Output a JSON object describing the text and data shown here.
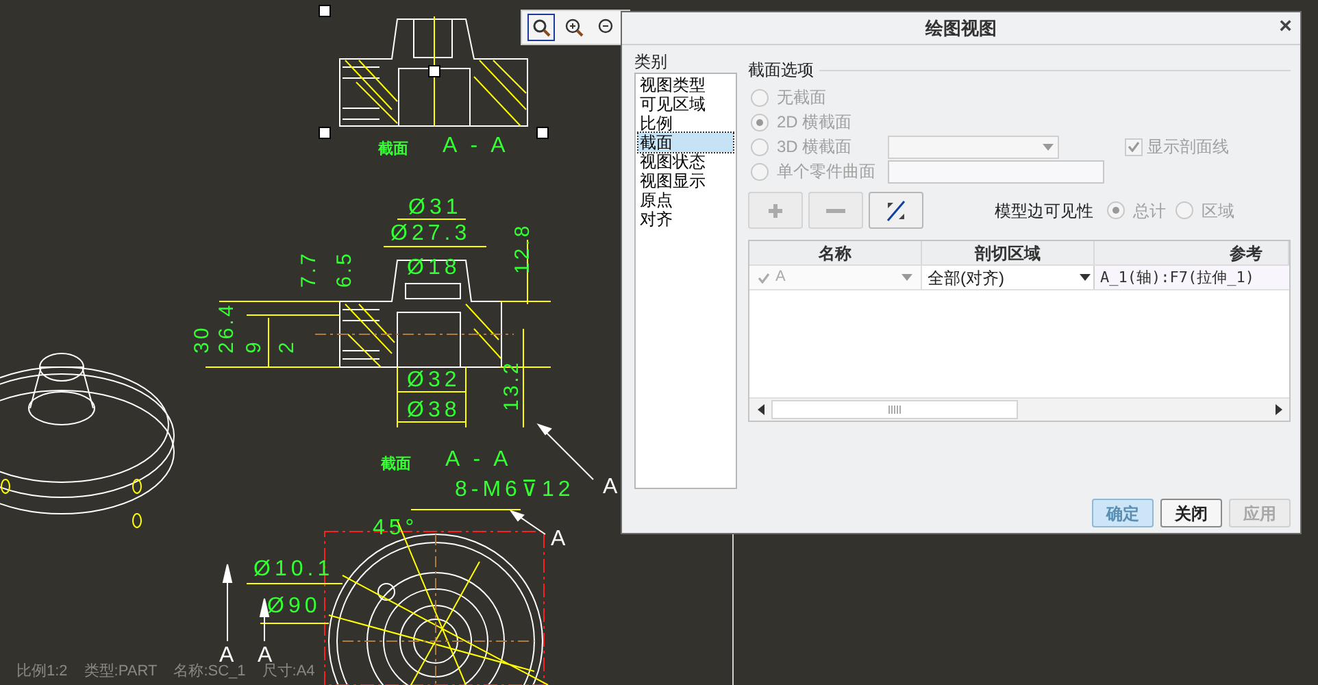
{
  "drawing": {
    "labels": [
      {
        "text": "截面",
        "kind": "caption"
      },
      {
        "text": "A - A",
        "kind": "dim"
      },
      {
        "text": "Ø31",
        "kind": "dim"
      },
      {
        "text": "Ø27.3",
        "kind": "dim"
      },
      {
        "text": "Ø18",
        "kind": "dim"
      },
      {
        "text": "7.7",
        "kind": "dim_v"
      },
      {
        "text": "6.5",
        "kind": "dim_v"
      },
      {
        "text": "12.8",
        "kind": "dim_v"
      },
      {
        "text": "30",
        "kind": "dim_v"
      },
      {
        "text": "26.4",
        "kind": "dim_v"
      },
      {
        "text": "9",
        "kind": "dim_v"
      },
      {
        "text": "2",
        "kind": "dim_v"
      },
      {
        "text": "Ø32",
        "kind": "dim"
      },
      {
        "text": "Ø38",
        "kind": "dim"
      },
      {
        "text": "13.2",
        "kind": "dim_v"
      },
      {
        "text": "截面",
        "kind": "caption"
      },
      {
        "text": "A - A",
        "kind": "dim"
      },
      {
        "text": "8-M6⊽12",
        "kind": "dim"
      },
      {
        "text": "A",
        "kind": "mark"
      },
      {
        "text": "45°",
        "kind": "dim"
      },
      {
        "text": "A",
        "kind": "mark"
      },
      {
        "text": "Ø10.1",
        "kind": "dim"
      },
      {
        "text": "Ø90",
        "kind": "dim"
      },
      {
        "text": "A",
        "kind": "mark"
      },
      {
        "text": "A",
        "kind": "mark"
      }
    ]
  },
  "status_bar": [
    "比例1:2",
    "类型:PART",
    "名称:SC_1",
    "尺寸:A4"
  ],
  "dialog": {
    "title": "绘图视图",
    "close": "×",
    "category_label": "类别",
    "categories": [
      {
        "label": "视图类型",
        "selected": false
      },
      {
        "label": "可见区域",
        "selected": false
      },
      {
        "label": "比例",
        "selected": false
      },
      {
        "label": "截面",
        "selected": true
      },
      {
        "label": "视图状态",
        "selected": false
      },
      {
        "label": "视图显示",
        "selected": false
      },
      {
        "label": "原点",
        "selected": false
      },
      {
        "label": "对齐",
        "selected": false
      }
    ],
    "section_options": {
      "title": "截面选项",
      "options": [
        {
          "label": "无截面",
          "kind": "plain",
          "selected": false,
          "disabled": true
        },
        {
          "prefix": "2D",
          "label": "横截面",
          "kind": "plain",
          "selected": true,
          "disabled": true
        },
        {
          "prefix": "3D",
          "label": "横截面",
          "kind": "select",
          "selected": false,
          "disabled": true
        },
        {
          "label": "单个零件曲面",
          "kind": "field",
          "selected": false,
          "disabled": true
        }
      ],
      "show_hatching": {
        "label": "显示剖面线",
        "checked": true,
        "disabled": true
      },
      "edge_visibility": {
        "label": "模型边可见性",
        "options": [
          {
            "label": "总计",
            "selected": true
          },
          {
            "label": "区域",
            "selected": false
          }
        ]
      }
    },
    "table": {
      "columns": [
        "名称",
        "剖切区域",
        "参考"
      ],
      "rows": [
        {
          "name": "A",
          "region": "全部(对齐)",
          "reference": "A_1(轴):F7(拉伸_1)"
        }
      ]
    },
    "buttons": [
      {
        "label": "确定",
        "default": true,
        "disabled": false
      },
      {
        "label": "关闭",
        "default": false,
        "disabled": false
      },
      {
        "label": "应用",
        "default": false,
        "disabled": true
      }
    ]
  }
}
